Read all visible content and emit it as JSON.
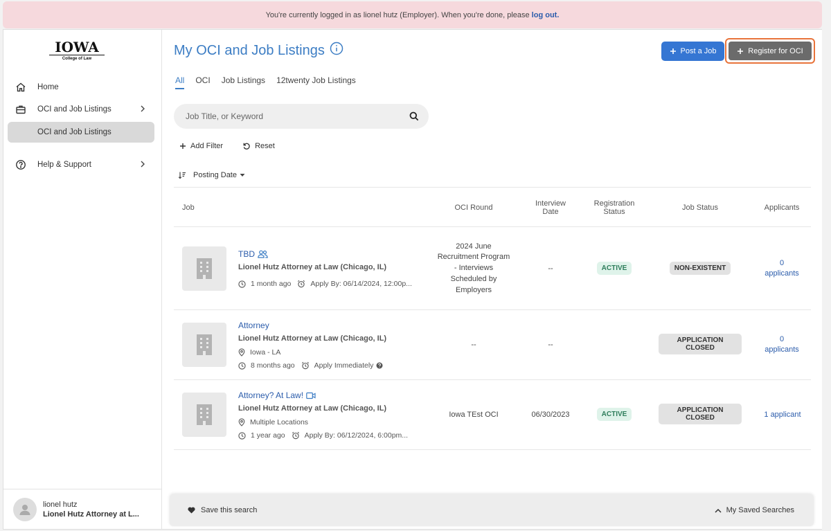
{
  "banner": {
    "text": "You're currently logged in as lionel hutz (Employer). When you're done, please",
    "link": "log out."
  },
  "logo": {
    "main": "IOWA",
    "sub": "College of Law"
  },
  "sidebar": {
    "items": [
      {
        "label": "Home",
        "icon": "home-icon"
      },
      {
        "label": "OCI and Job Listings",
        "icon": "briefcase-icon"
      },
      {
        "label": "OCI and Job Listings"
      },
      {
        "label": "Help & Support",
        "icon": "help-icon"
      }
    ]
  },
  "user": {
    "name": "lionel hutz",
    "org": "Lionel Hutz Attorney at L..."
  },
  "page": {
    "title": "My OCI and Job Listings"
  },
  "actions": {
    "post": "Post a Job",
    "register": "Register for OCI"
  },
  "tabs": [
    "All",
    "OCI",
    "Job Listings",
    "12twenty Job Listings"
  ],
  "search": {
    "placeholder": "Job Title, or Keyword"
  },
  "filters": {
    "add": "Add Filter",
    "reset": "Reset"
  },
  "sort": {
    "label": "Posting Date"
  },
  "columns": {
    "job": "Job",
    "oci_round": "OCI Round",
    "interview_date": "Interview Date",
    "registration_status": "Registration Status",
    "job_status": "Job Status",
    "applicants": "Applicants"
  },
  "rows": [
    {
      "title": "TBD",
      "employer": "Lionel Hutz Attorney at Law (Chicago, IL)",
      "posted": "1 month ago",
      "apply": "Apply By: 06/14/2024, 12:00p...",
      "oci_round": "2024 June Recruitment Program - Interviews Scheduled by Employers",
      "interview_date": "--",
      "registration_status": "ACTIVE",
      "job_status": "NON-EXISTENT",
      "applicants": "0 applicants"
    },
    {
      "title": "Attorney",
      "employer": "Lionel Hutz Attorney at Law (Chicago, IL)",
      "location": "Iowa - LA",
      "posted": "8 months ago",
      "apply": "Apply Immediately",
      "oci_round": "--",
      "interview_date": "--",
      "registration_status": "",
      "job_status": "APPLICATION CLOSED",
      "applicants": "0 applicants"
    },
    {
      "title": "Attorney? At Law!",
      "employer": "Lionel Hutz Attorney at Law (Chicago, IL)",
      "location": "Multiple Locations",
      "posted": "1 year ago",
      "apply": "Apply By: 06/12/2024, 6:00pm...",
      "oci_round": "Iowa TEst OCI",
      "interview_date": "06/30/2023",
      "registration_status": "ACTIVE",
      "job_status": "APPLICATION CLOSED",
      "applicants": "1 applicant"
    }
  ],
  "savebar": {
    "save": "Save this search",
    "saved": "My Saved Searches"
  },
  "colors": {
    "accent": "#3c7dc4",
    "primary_button": "#3576d3",
    "highlight": "#e8733a",
    "banner": "#f6d9dd"
  }
}
